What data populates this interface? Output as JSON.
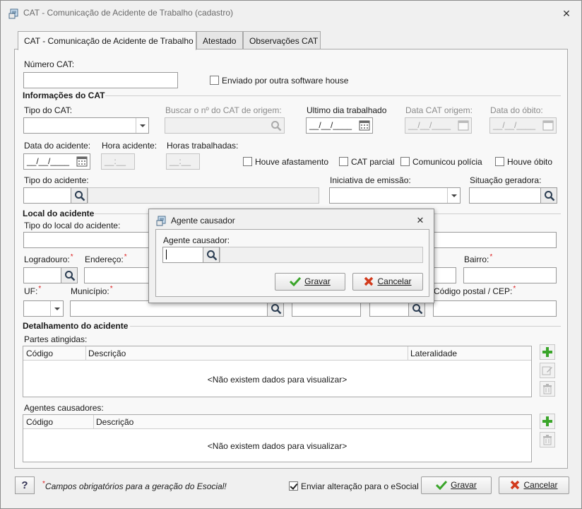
{
  "window": {
    "title": "CAT - Comunicação de Acidente de Trabalho (cadastro)"
  },
  "tabs": [
    {
      "label": "CAT - Comunicação de Acidente de Trabalho"
    },
    {
      "label": "Atestado"
    },
    {
      "label": "Observações CAT"
    }
  ],
  "cat": {
    "numero_label": "Número CAT:",
    "enviado_label": "Enviado por outra software house",
    "info_section": "Informações do CAT",
    "tipo_label": "Tipo do CAT:",
    "buscar_label": "Buscar o nº do CAT de origem:",
    "ultimo_dia_label": "Ultimo dia trabalhado",
    "ultimo_dia_value": "__/__/____",
    "data_origem_label": "Data CAT origem:",
    "data_origem_value": "__/__/____",
    "data_obito_label": "Data do óbito:",
    "data_obito_value": "__/__/____",
    "data_acidente_label": "Data do acidente:",
    "data_acidente_value": "__/__/____",
    "hora_acidente_label": "Hora acidente:",
    "hora_acidente_value": "__:__",
    "horas_trab_label": "Horas trabalhadas:",
    "horas_trab_value": "__:__",
    "houve_afastamento": "Houve afastamento",
    "cat_parcial": "CAT parcial",
    "comunicou_policia": "Comunicou polícia",
    "houve_obito": "Houve óbito",
    "tipo_acidente_label": "Tipo do acidente:",
    "iniciativa_label": "Iniciativa de emissão:",
    "situacao_label": "Situação geradora:"
  },
  "local": {
    "section": "Local do acidente",
    "tipo_local_label": "Tipo do local do acidente:",
    "logradouro_label": "Logradouro:",
    "endereco_label": "Endereço:",
    "bairro_label": "Bairro:",
    "uf_label": "UF:",
    "municipio_label": "Município:",
    "cep_label": "Código postal / CEP:",
    "required_mark": "*"
  },
  "detalhe": {
    "section": "Detalhamento do acidente",
    "partes_label": "Partes atingidas:",
    "partes_cols": [
      "Código",
      "Descrição",
      "Lateralidade"
    ],
    "partes_empty": "<Não existem dados para visualizar>",
    "agentes_label": "Agentes causadores:",
    "agentes_cols": [
      "Código",
      "Descrição"
    ],
    "agentes_empty": "<Não existem dados para visualizar>"
  },
  "footer": {
    "help": "?",
    "required_mark": "*",
    "footnote": "Campos obrigatórios para a geração do Esocial!",
    "enviar_label": "Enviar alteração para o eSocial",
    "gravar": "Gravar",
    "cancelar": "Cancelar"
  },
  "modal": {
    "title": "Agente causador",
    "field_label": "Agente causador:",
    "gravar": "Gravar",
    "cancelar": "Cancelar"
  },
  "colors": {
    "required": "#dd2222",
    "add": "#3aa52a",
    "cancel": "#d23a1c"
  }
}
